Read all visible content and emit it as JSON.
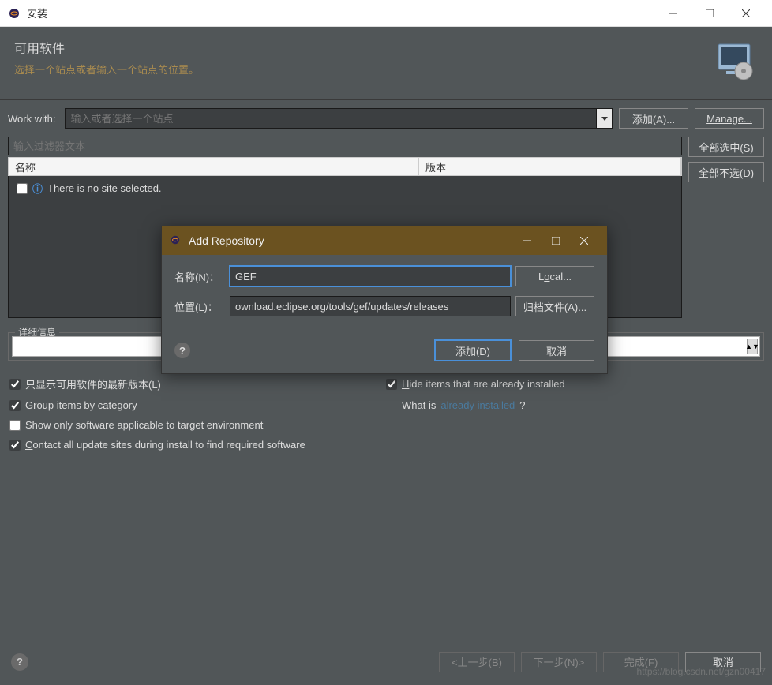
{
  "titlebar": {
    "title": "安装"
  },
  "header": {
    "title": "可用软件",
    "subtitle": "选择一个站点或者输入一个站点的位置。"
  },
  "workwith": {
    "label": "Work with:",
    "placeholder": "输入或者选择一个站点",
    "add_label": "添加(A)...",
    "manage_label": "Manage..."
  },
  "filter": {
    "placeholder": "输入过滤器文本"
  },
  "table": {
    "col_name": "名称",
    "col_version": "版本",
    "empty_msg": "There is no site selected."
  },
  "sidebtns": {
    "select_all": "全部选中(S)",
    "deselect_all": "全部不选(D)"
  },
  "details": {
    "legend": "详细信息"
  },
  "options": {
    "latest_only": "只显示可用软件的最新版本(L)",
    "hide_installed": "Hide items that are already installed",
    "group_by_cat": "Group items by category",
    "what_is_prefix": "What is ",
    "what_is_link": "already installed",
    "qmark": "?",
    "target_env": "Show only software applicable to target environment",
    "contact_sites": "Contact all update sites during install to find required software"
  },
  "footer": {
    "back": "<上一步(B)",
    "next": "下一步(N)>",
    "finish": "完成(F)",
    "cancel": "取消"
  },
  "dialog": {
    "title": "Add Repository",
    "name_label": "名称(N)：",
    "name_value": "GEF",
    "local_btn": "Local...",
    "loc_label": "位置(L)：",
    "loc_value": "ownload.eclipse.org/tools/gef/updates/releases",
    "archive_btn": "归档文件(A)...",
    "add_btn": "添加(D)",
    "cancel_btn": "取消"
  },
  "watermark": "https://blog.csdn.net/gzn00417"
}
